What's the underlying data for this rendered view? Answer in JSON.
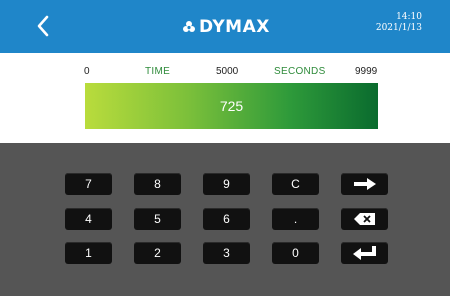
{
  "header": {
    "logo_text": "DYMAX",
    "time": "14:10",
    "date": "2021/1/13",
    "back_icon": "chevron-left-icon"
  },
  "scale": {
    "min": "0",
    "time_label": "TIME",
    "mid": "5000",
    "unit_label": "SECONDS",
    "max": "9999"
  },
  "time_value": "725",
  "keypad": {
    "row1": [
      "7",
      "8",
      "9",
      "C"
    ],
    "row2": [
      "4",
      "5",
      "6",
      "."
    ],
    "row3": [
      "1",
      "2",
      "3",
      "0"
    ],
    "icons": [
      "arrow-right-icon",
      "backspace-icon",
      "enter-icon"
    ]
  },
  "colors": {
    "header": "#1f86c9",
    "keypad_bg": "#555555",
    "key_bg": "#111111",
    "label_green": "#2e8b3a"
  }
}
